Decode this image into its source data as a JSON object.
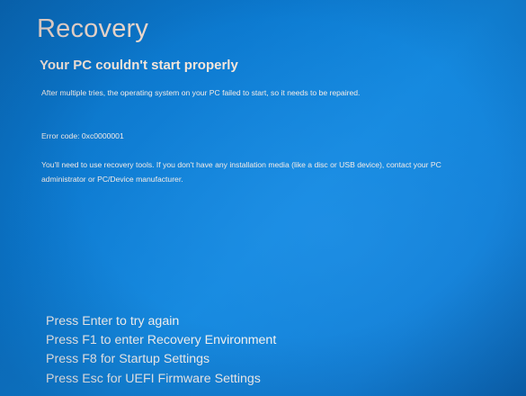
{
  "recovery": {
    "title": "Recovery",
    "subtitle": "Your PC couldn't start properly",
    "message": "After multiple tries, the operating system on your PC failed to start, so it needs to be repaired.",
    "error_code": "Error code: 0xc0000001",
    "instructions": "You'll need to use recovery tools. If you don't have any installation media (like a disc or USB device), contact your PC administrator or PC/Device manufacturer."
  },
  "options": [
    {
      "label": "Press Enter to try again"
    },
    {
      "label": "Press F1 to enter Recovery Environment"
    },
    {
      "label": "Press F8 for Startup Settings"
    },
    {
      "label": "Press Esc for UEFI Firmware Settings"
    }
  ],
  "colors": {
    "background": "#0b79cf",
    "title_text": "#f3ddd0",
    "body_text": "#f5ece6"
  }
}
